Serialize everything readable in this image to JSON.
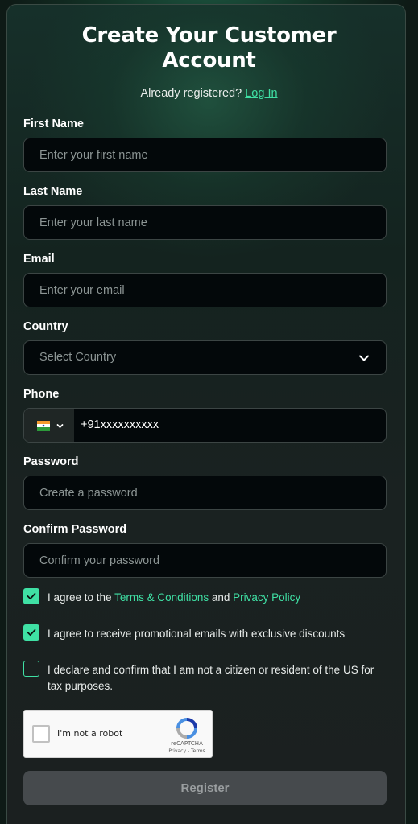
{
  "header": {
    "title_line1": "Create Your Customer",
    "title_line2": "Account",
    "already_registered": "Already registered?",
    "login_link": "Log In"
  },
  "form": {
    "first_name": {
      "label": "First Name",
      "placeholder": "Enter your first name",
      "value": ""
    },
    "last_name": {
      "label": "Last Name",
      "placeholder": "Enter your last name",
      "value": ""
    },
    "email": {
      "label": "Email",
      "placeholder": "Enter your email",
      "value": ""
    },
    "country": {
      "label": "Country",
      "placeholder": "Select Country",
      "selected": ""
    },
    "phone": {
      "label": "Phone",
      "country_flag": "india-flag-icon",
      "value": "+91xxxxxxxxxx"
    },
    "password": {
      "label": "Password",
      "placeholder": "Create a password",
      "value": ""
    },
    "confirm_password": {
      "label": "Confirm Password",
      "placeholder": "Confirm your password",
      "value": ""
    }
  },
  "consents": {
    "terms": {
      "checked": true,
      "prefix": "I agree to the ",
      "terms_link": "Terms & Conditions",
      "middle": " and ",
      "privacy_link": "Privacy Policy"
    },
    "promo": {
      "checked": true,
      "text": "I agree to receive promotional emails with exclusive discounts"
    },
    "us_tax": {
      "checked": false,
      "text": "I declare and confirm that I am not a citizen or resident of the US for tax purposes."
    }
  },
  "recaptcha": {
    "label": "I'm not a robot",
    "brand": "reCAPTCHA",
    "terms": "Privacy - Terms"
  },
  "register_button": "Register",
  "colors": {
    "accent": "#3fe0a4",
    "input_bg": "#03080a",
    "button_disabled_bg": "#464a4d"
  }
}
